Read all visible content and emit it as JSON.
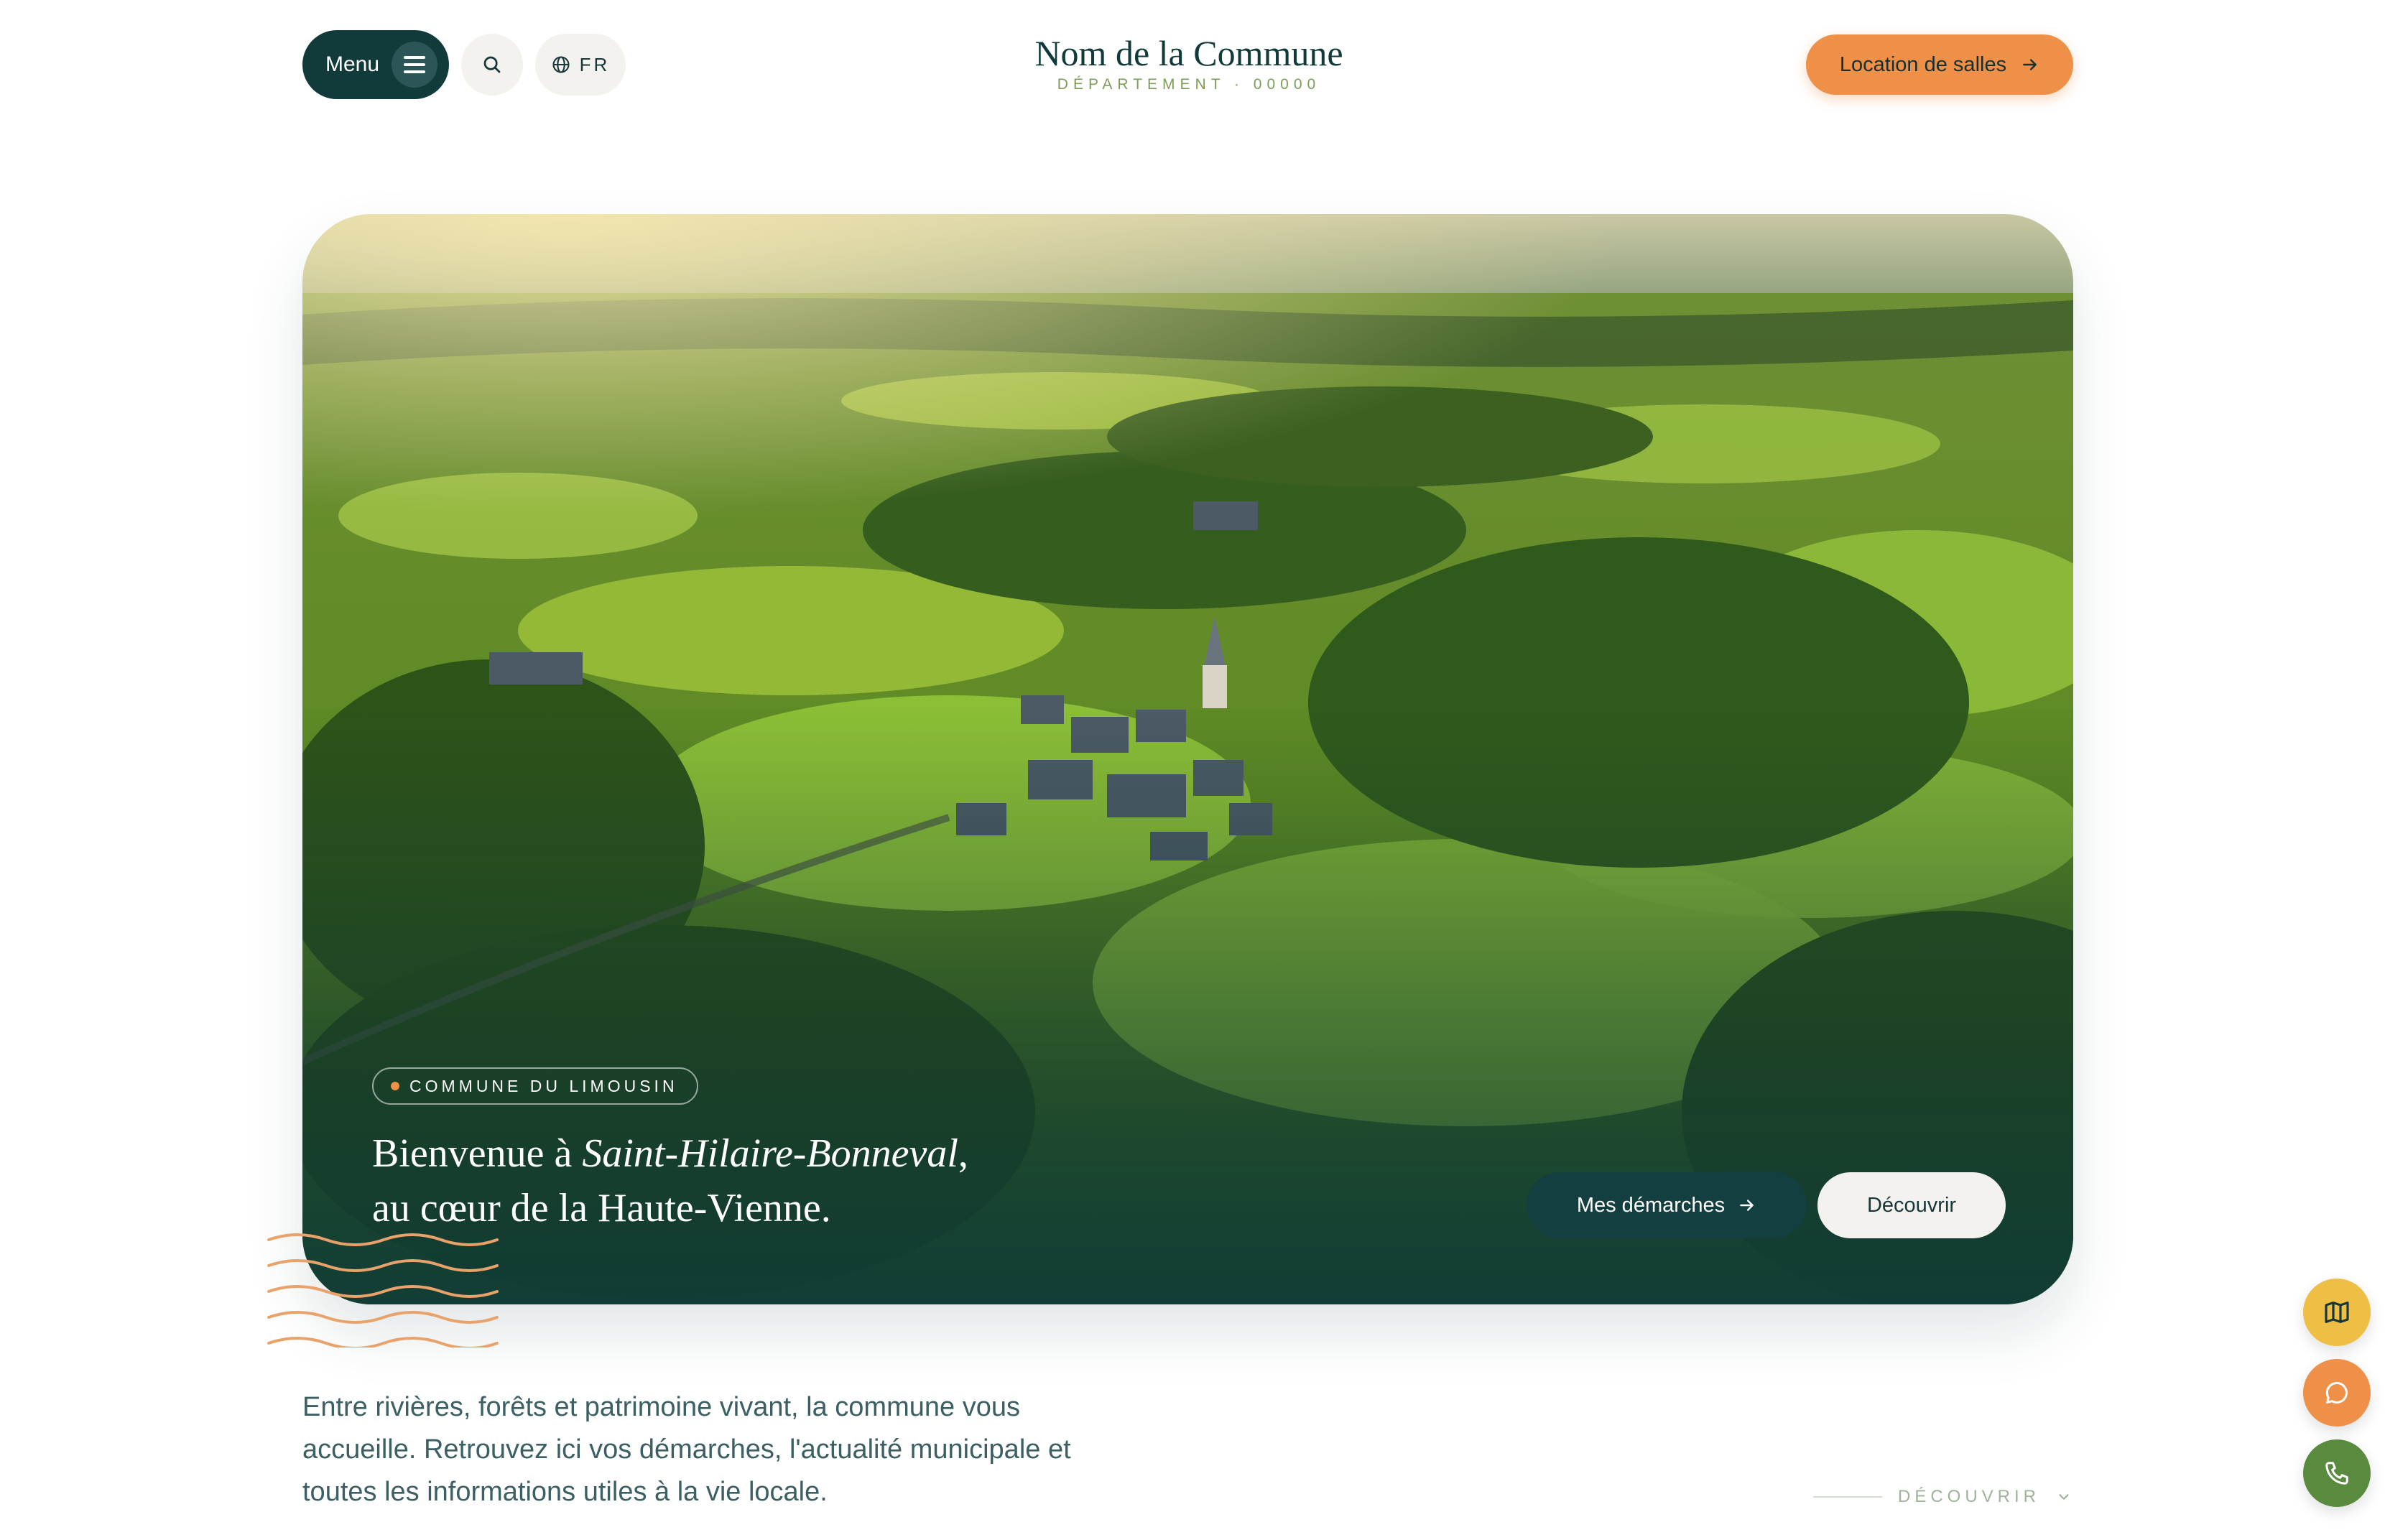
{
  "header": {
    "menu_label": "Menu",
    "lang_label": "FR",
    "logo_name": "Nom de la Commune",
    "logo_department": "DÉPARTEMENT · 00000",
    "cta_label": "Location de salles"
  },
  "hero": {
    "badge": "COMMUNE DU LIMOUSIN",
    "title_prefix": "Bienvenue à ",
    "title_place": "Saint-Hilaire-Bonneval",
    "title_comma": ",",
    "title_line2": "au cœur de la Haute-Vienne.",
    "primary_button": "Mes démarches",
    "secondary_button": "Découvrir"
  },
  "intro": {
    "text": "Entre rivières, forêts et patrimoine vivant, la commune vous accueille. Retrouvez ici vos démarches, l'actualité municipale et toutes les informations utiles à la vie locale."
  },
  "scroll_hint": {
    "label": "DÉCOUVRIR"
  },
  "floating_actions": [
    {
      "icon": "map-icon",
      "color": "#efbf45"
    },
    {
      "icon": "chat-icon",
      "color": "#ef9049"
    },
    {
      "icon": "phone-icon",
      "color": "#5a8a3e"
    }
  ],
  "colors": {
    "brand_dark": "#123a3b",
    "accent_orange": "#ef9049",
    "accent_green": "#7d9d58"
  }
}
